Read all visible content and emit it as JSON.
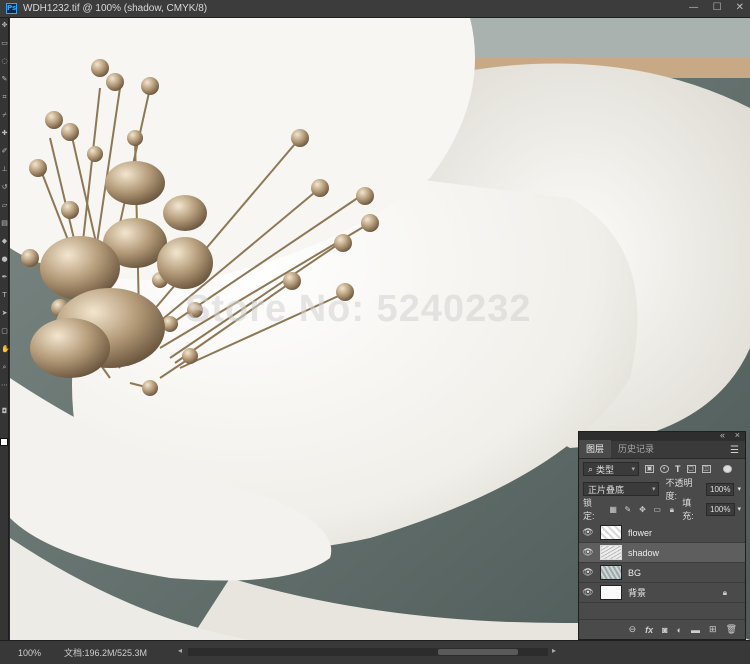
{
  "window": {
    "title": "WDH1232.tif @ 100% (shadow, CMYK/8)",
    "app_icon": "Ps",
    "controls": [
      "—",
      "☐",
      "✕"
    ]
  },
  "canvas": {
    "watermark": "Store No: 5240232"
  },
  "status_bar": {
    "zoom": "100%",
    "doc_size": "文档:196.2M/525.3M"
  },
  "layers_panel": {
    "tabs": [
      "图层",
      "历史记录"
    ],
    "active_tab": 0,
    "filter_label": "类型",
    "blend_mode": "正片叠底",
    "opacity_label": "不透明度:",
    "opacity_value": "100%",
    "lock_label": "锁定:",
    "fill_label": "填充:",
    "fill_value": "100%",
    "layers": [
      {
        "name": "flower",
        "visible": true,
        "selected": false,
        "locked": false,
        "thumb": "flower"
      },
      {
        "name": "shadow",
        "visible": true,
        "selected": true,
        "locked": false,
        "thumb": "shadow"
      },
      {
        "name": "BG",
        "visible": true,
        "selected": false,
        "locked": false,
        "thumb": "bg"
      },
      {
        "name": "背景",
        "visible": true,
        "selected": false,
        "locked": true,
        "thumb": "plain"
      }
    ],
    "bottom_icons": [
      "link-icon",
      "fx-icon",
      "mask-icon",
      "adjustment-icon",
      "folder-icon",
      "new-layer-icon",
      "trash-icon"
    ]
  }
}
